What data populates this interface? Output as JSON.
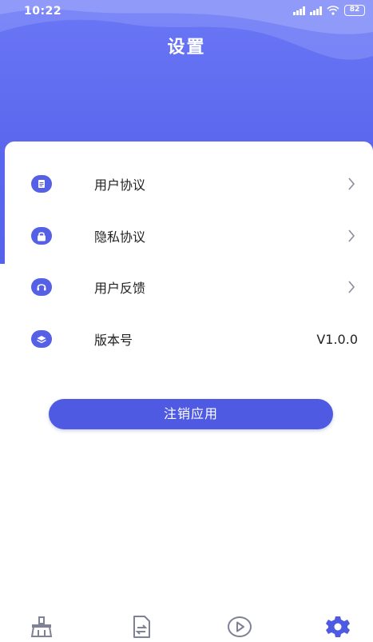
{
  "status_bar": {
    "time": "10:22",
    "battery": "82"
  },
  "header": {
    "title": "设置"
  },
  "settings": {
    "items": [
      {
        "label": "用户协议",
        "icon": "document-icon",
        "has_chevron": true
      },
      {
        "label": "隐私协议",
        "icon": "lock-icon",
        "has_chevron": true
      },
      {
        "label": "用户反馈",
        "icon": "headset-icon",
        "has_chevron": true
      },
      {
        "label": "版本号",
        "icon": "layers-icon",
        "value": "V1.0.0"
      }
    ]
  },
  "logout_button": {
    "label": "注销应用"
  },
  "tabbar": {
    "tabs": [
      {
        "icon": "broom-icon",
        "active": false
      },
      {
        "icon": "file-transfer-icon",
        "active": false
      },
      {
        "icon": "play-circle-icon",
        "active": false
      },
      {
        "icon": "gear-icon",
        "active": true
      }
    ]
  },
  "colors": {
    "header_bg": "#5b68ee",
    "accent": "#4f5ae3",
    "icon_inactive": "#7d8295"
  }
}
